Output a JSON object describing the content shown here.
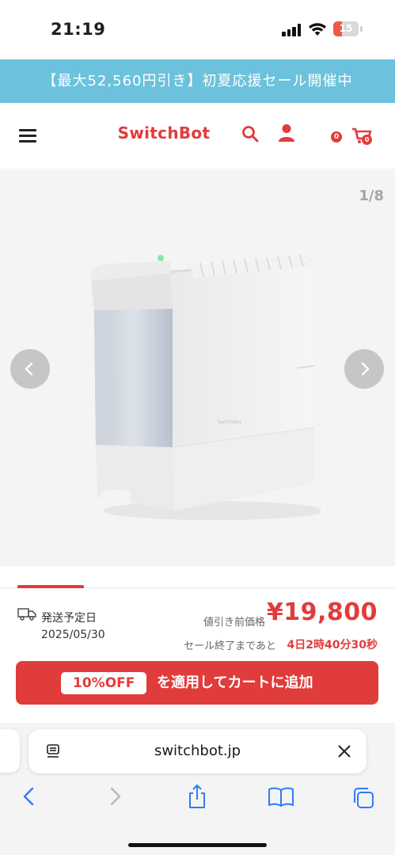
{
  "status_bar": {
    "time": "21:19",
    "battery": "15"
  },
  "promo": {
    "text": "【最大52,560円引き】初夏応援セール開催中"
  },
  "header": {
    "logo": "SwitchBot",
    "cart_count": "0",
    "cart_badge": "0",
    "brand_color": "#e23b3b"
  },
  "gallery": {
    "pager": "1/8",
    "product_label": "SwitchBot"
  },
  "purchase": {
    "ship_label": "発送予定日",
    "ship_date": "2025/05/30",
    "price_label": "値引き前価格",
    "price": "¥19,800",
    "countdown_label": "セール終了まであと",
    "countdown": "4日2時40分30秒",
    "discount_chip": "10%OFF",
    "cta": "を適用してカートに追加"
  },
  "browser": {
    "url": "switchbot.jp",
    "toolbar": [
      "back-icon",
      "forward-icon",
      "share-icon",
      "bookmarks-icon",
      "tabs-icon"
    ]
  }
}
